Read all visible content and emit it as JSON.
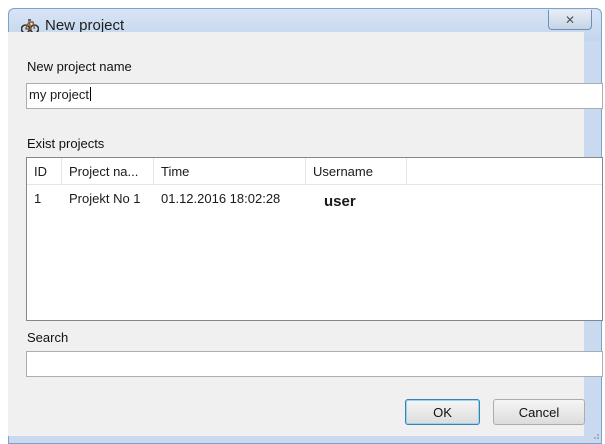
{
  "window": {
    "title": "New project",
    "icon": "bicycle-icon",
    "close_glyph": "✕"
  },
  "new_project": {
    "label": "New project name",
    "value": "my project"
  },
  "exist": {
    "label": "Exist projects",
    "columns": [
      "ID",
      "Project na...",
      "Time",
      "Username"
    ],
    "rows": [
      {
        "id": "1",
        "name": "Projekt No 1",
        "time": "01.12.2016 18:02:28",
        "user": "user"
      }
    ]
  },
  "search": {
    "label": "Search",
    "value": ""
  },
  "buttons": {
    "ok": "OK",
    "cancel": "Cancel"
  },
  "colors": {
    "titlebar": "#c9daf0",
    "border": "#7da2ce",
    "default_button": "#3c7fb1"
  }
}
